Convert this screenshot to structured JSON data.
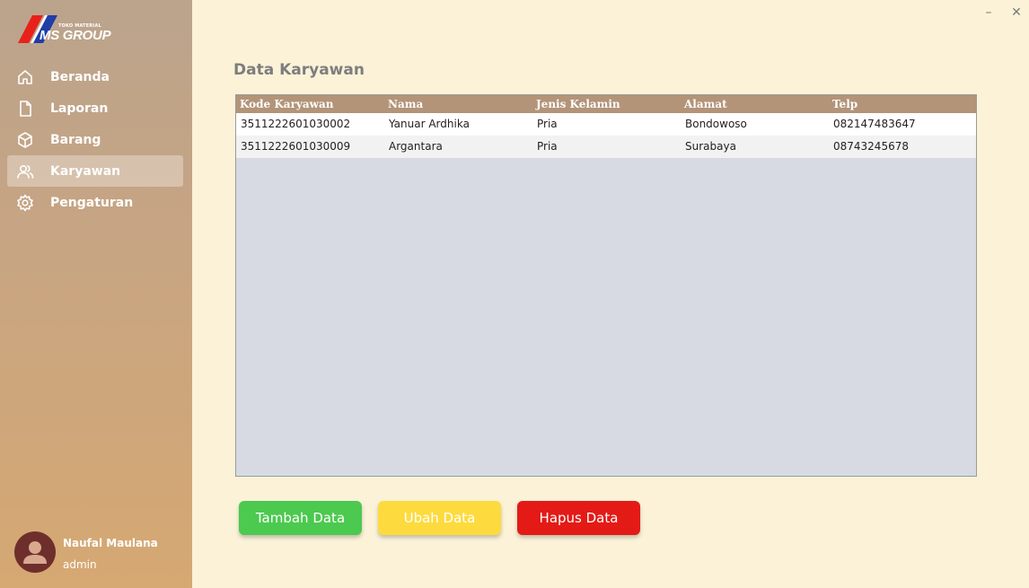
{
  "logo": {
    "tagline": "TOKO MATERIAL",
    "brand": "MS GROUP"
  },
  "sidebar": {
    "items": [
      {
        "label": "Beranda",
        "icon": "home-icon"
      },
      {
        "label": "Laporan",
        "icon": "file-icon"
      },
      {
        "label": "Barang",
        "icon": "box-icon"
      },
      {
        "label": "Karyawan",
        "icon": "users-icon",
        "active": true
      },
      {
        "label": "Pengaturan",
        "icon": "gear-icon"
      }
    ]
  },
  "user": {
    "name": "Naufal Maulana",
    "role": "admin"
  },
  "window": {
    "minimize": "–",
    "close": "✕"
  },
  "page": {
    "title": "Data Karyawan"
  },
  "table": {
    "columns": [
      "Kode Karyawan",
      "Nama",
      "Jenis Kelamin",
      "Alamat",
      "Telp"
    ],
    "rows": [
      [
        "3511222601030002",
        "Yanuar Ardhika",
        "Pria",
        "Bondowoso",
        "082147483647"
      ],
      [
        "3511222601030009",
        "Argantara",
        "Pria",
        "Surabaya",
        "08743245678"
      ]
    ]
  },
  "buttons": {
    "add": {
      "label": "Tambah Data",
      "color": "#4cc94f"
    },
    "edit": {
      "label": "Ubah Data",
      "color": "#fddb3e"
    },
    "delete": {
      "label": "Hapus Data",
      "color": "#e41a16"
    }
  },
  "colors": {
    "background": "#fbf2d8",
    "table_header": "#b39479",
    "table_empty": "#d7dae2"
  }
}
